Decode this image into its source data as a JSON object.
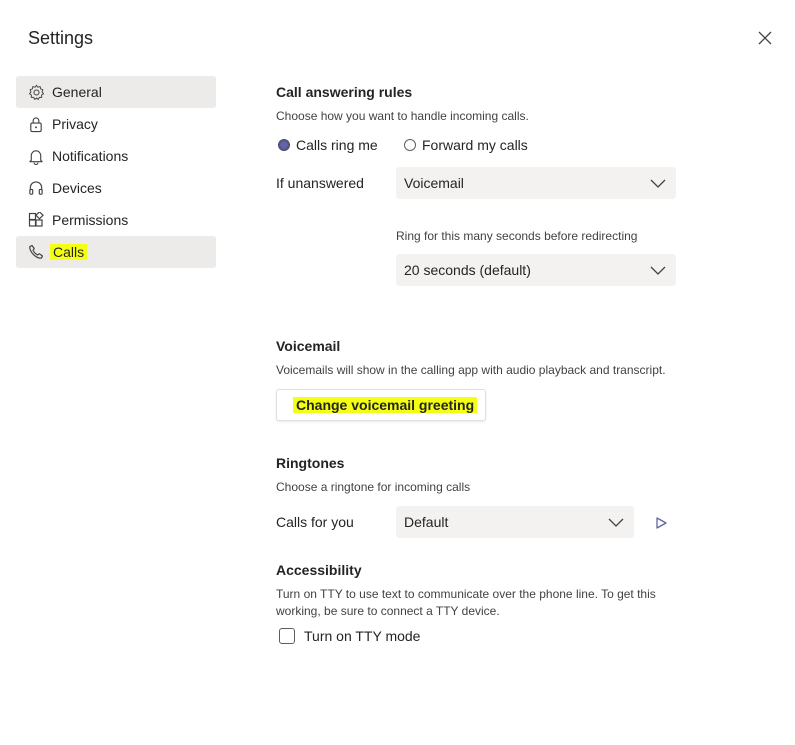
{
  "window": {
    "title": "Settings"
  },
  "sidebar": {
    "items": [
      {
        "label": "General",
        "icon": "gear-icon",
        "active": true
      },
      {
        "label": "Privacy",
        "icon": "lock-icon",
        "active": false
      },
      {
        "label": "Notifications",
        "icon": "bell-icon",
        "active": false
      },
      {
        "label": "Devices",
        "icon": "headset-icon",
        "active": false
      },
      {
        "label": "Permissions",
        "icon": "apps-icon",
        "active": false
      },
      {
        "label": "Calls",
        "icon": "phone-icon",
        "active": true,
        "highlighted": true
      }
    ]
  },
  "call_answering": {
    "heading": "Call answering rules",
    "description": "Choose how you want to handle incoming calls.",
    "option_ring": "Calls ring me",
    "option_forward": "Forward my calls",
    "selected_option": "Calls ring me",
    "if_unanswered_label": "If unanswered",
    "if_unanswered_value": "Voicemail",
    "ring_label": "Ring for this many seconds before redirecting",
    "ring_value": "20 seconds (default)"
  },
  "voicemail": {
    "heading": "Voicemail",
    "description": "Voicemails will show in the calling app with audio playback and transcript.",
    "button_label": "Change voicemail greeting"
  },
  "ringtones": {
    "heading": "Ringtones",
    "description": "Choose a ringtone for incoming calls",
    "calls_for_you_label": "Calls for you",
    "calls_for_you_value": "Default"
  },
  "accessibility": {
    "heading": "Accessibility",
    "description_line1": "Turn on TTY to use text to communicate over the phone line. To get this",
    "description_line2": "working, be sure to connect a TTY device.",
    "tty_label": "Turn on TTY mode",
    "tty_checked": false
  },
  "colors": {
    "highlight": "#f5ff12",
    "accent": "#6264a7",
    "nav_active_bg": "#edebe9",
    "select_bg": "#f3f2f1"
  }
}
